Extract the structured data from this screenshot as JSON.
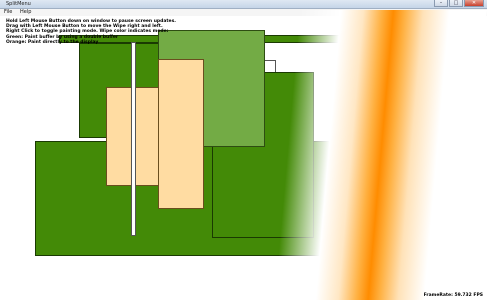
{
  "window": {
    "title": "SplitMenu",
    "buttons": {
      "minimize": "–",
      "maximize": "□",
      "close": "✕"
    }
  },
  "menubar": {
    "items": [
      "File",
      "Help"
    ]
  },
  "instructions": [
    "Hold Left Mouse Button down on window to pause screen updates.",
    "Drag with Left Mouse Button to move the Wipe right and left.",
    "Right Click to toggle painting mode.   Wipe color indicates mode:",
    "     Green:  Paint buffer by using a double buffer",
    "     Orange:  Paint directly to the display"
  ],
  "status": {
    "text": "FrameRate: 59.732 FPS"
  },
  "colors": {
    "dark_green": "#438a07",
    "light_green": "#73ab45",
    "peach": "#ffdca2",
    "wipe_orange": "#ff8c00"
  }
}
